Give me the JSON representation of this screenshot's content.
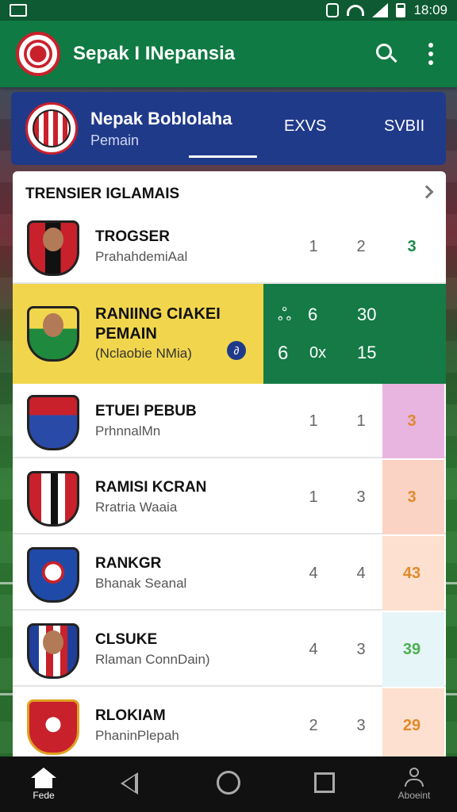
{
  "status": {
    "time": "18:09"
  },
  "appbar": {
    "title": "Sepak I INepansia"
  },
  "header": {
    "title": "Nepak Boblolaha",
    "subtitle": "Pemain",
    "tabs": [
      "EXVS",
      "SVBII"
    ]
  },
  "section": {
    "title": "TRENSIER IGLAMAIS"
  },
  "rows": [
    {
      "name": "TROGSER",
      "sub": "PrahahdemiAal",
      "a": "1",
      "b": "2",
      "c": "3",
      "hl": "#ffffff",
      "c_color": "#1a8a4a"
    },
    {
      "name": "ETUEI PEBUB",
      "sub": "PrhnnalMn",
      "a": "1",
      "b": "1",
      "c": "3",
      "hl": "#e8b4e0",
      "c_color": "#e08a2a"
    },
    {
      "name": "RAMISI KCRAN",
      "sub": "Rratria Waaia",
      "a": "1",
      "b": "3",
      "c": "3",
      "hl": "#fbd3c4",
      "c_color": "#e08a2a"
    },
    {
      "name": "RANKGR",
      "sub": "Bhanak Seanal",
      "a": "4",
      "b": "4",
      "c": "43",
      "hl": "#fde0cf",
      "c_color": "#e08a2a"
    },
    {
      "name": "CLSUKE",
      "sub": "Rlaman ConnDain)",
      "a": "4",
      "b": "3",
      "c": "39",
      "hl": "#e6f5f8",
      "c_color": "#4caf50"
    },
    {
      "name": "RLOKIAM",
      "sub": "PhaninPlepah",
      "a": "2",
      "b": "3",
      "c": "29",
      "hl": "#fde0cf",
      "c_color": "#e08a2a"
    }
  ],
  "highlight": {
    "name_line1": "RANIING CIAKEI",
    "name_line2": "PEMAIN",
    "sub": "(Nclaobie NMia)",
    "info": "∂",
    "top_icon": "ஃ",
    "top_a": "6",
    "top_b": "30",
    "bot_a": "6",
    "bot_b": "0x",
    "bot_c": "15"
  },
  "nav": {
    "home_label": "Fede",
    "account_label": "Aboeint"
  },
  "colors": {
    "appbar": "#0f7a43",
    "header": "#203a8a",
    "highlight_yellow": "#f1d64d",
    "highlight_green": "#157a46"
  }
}
